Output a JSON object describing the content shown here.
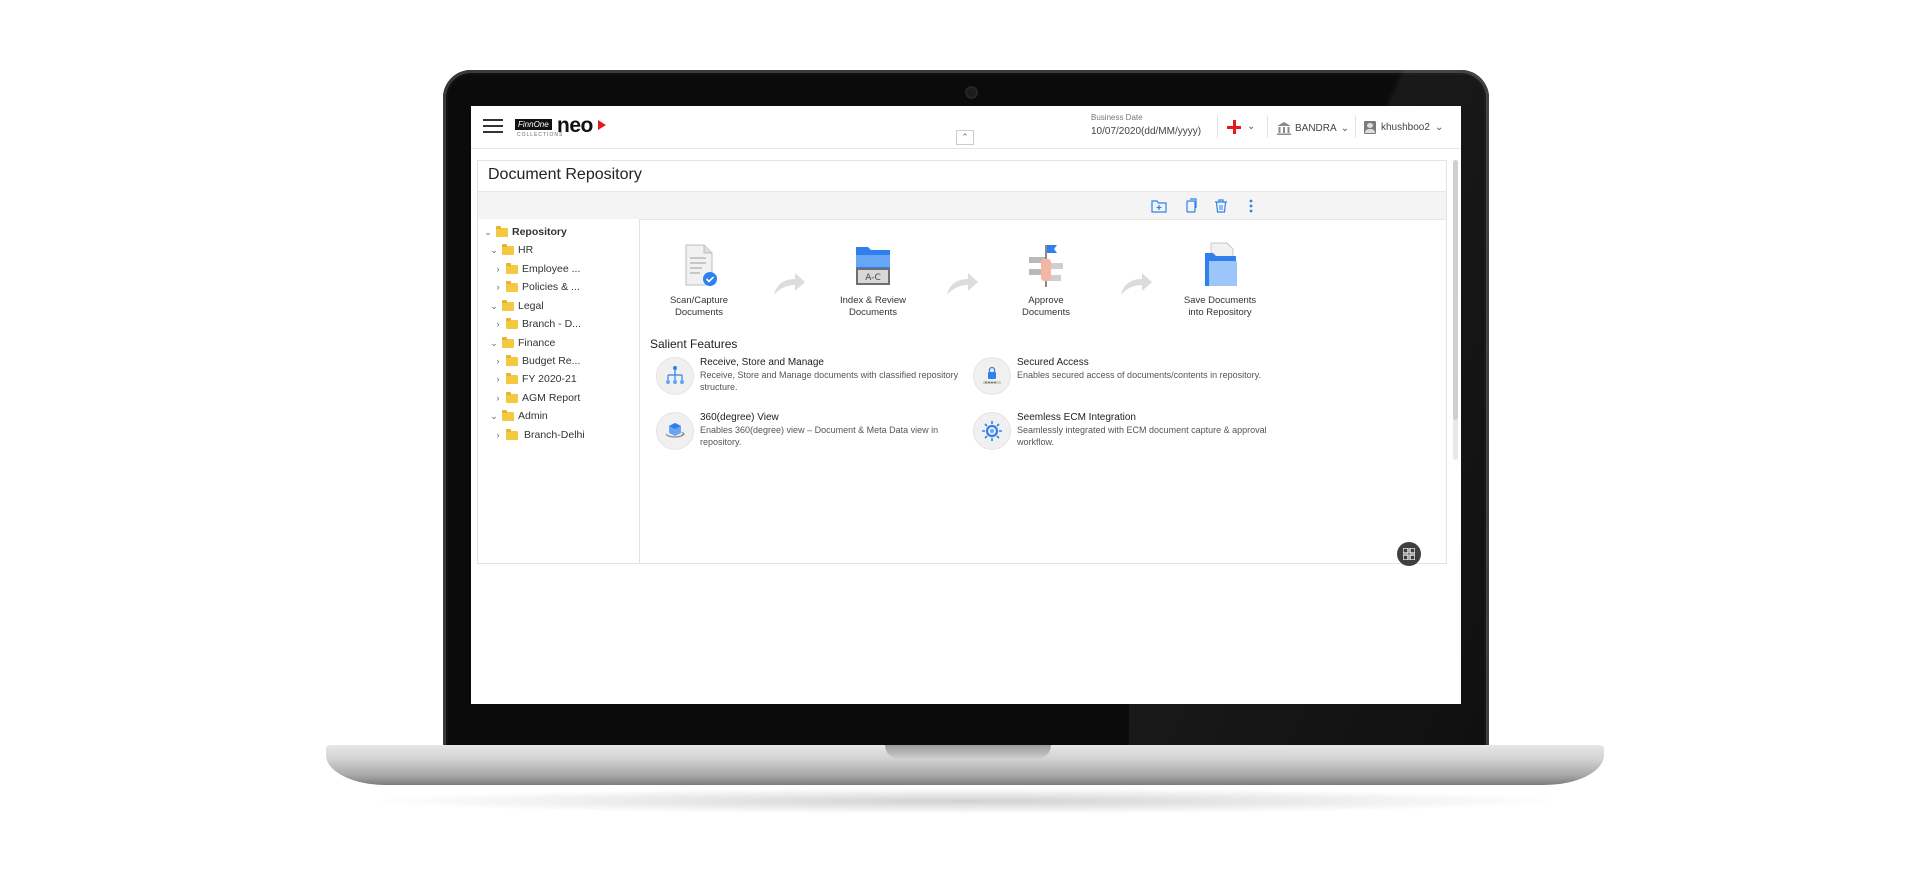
{
  "header": {
    "logo_brand": "FinnOne",
    "logo_product": "neo",
    "logo_sub": "COLLECTIONS",
    "business_date_label": "Business Date",
    "business_date_value": "10/07/2020(dd/MM/yyyy)",
    "branch": "BANDRA",
    "user": "khushboo2"
  },
  "page": {
    "title": "Document Repository"
  },
  "toolbar": {
    "icons": [
      "new-folder-icon",
      "copy-icon",
      "trash-icon",
      "more-vertical-icon"
    ]
  },
  "tree": {
    "root": "Repository",
    "items": [
      {
        "label": "HR",
        "level": 1,
        "expanded": true
      },
      {
        "label": "Employee ...",
        "level": 2,
        "expanded": false
      },
      {
        "label": "Policies & ...",
        "level": 2,
        "expanded": false
      },
      {
        "label": "Legal",
        "level": 1,
        "expanded": true
      },
      {
        "label": "Branch - D...",
        "level": 2,
        "expanded": false
      },
      {
        "label": "Finance",
        "level": 1,
        "expanded": true
      },
      {
        "label": "Budget Re...",
        "level": 2,
        "expanded": false
      },
      {
        "label": "FY 2020-21",
        "level": 2,
        "expanded": false
      },
      {
        "label": "AGM Report",
        "level": 2,
        "expanded": false
      },
      {
        "label": "Admin",
        "level": 1,
        "expanded": true
      },
      {
        "label": "Branch-Delhi",
        "level": 2,
        "expanded": false
      }
    ]
  },
  "workflow": {
    "steps": [
      {
        "line1": "Scan/Capture",
        "line2": "Documents"
      },
      {
        "line1": "Index & Review",
        "line2": "Documents"
      },
      {
        "line1": "Approve",
        "line2": "Documents"
      },
      {
        "line1": "Save Documents",
        "line2": "into Repository"
      }
    ],
    "index_badge": "A-C"
  },
  "salient": {
    "heading": "Salient Features",
    "features": [
      {
        "title": "Receive, Store and Manage",
        "desc": "Receive, Store and Manage documents with classified repository structure."
      },
      {
        "title": "Secured Access",
        "desc": "Enables secured access of documents/contents in repository."
      },
      {
        "title": "360(degree) View",
        "desc": "Enables 360(degree) view – Document & Meta Data view in repository."
      },
      {
        "title": "Seemless ECM Integration",
        "desc": "Seamlessly integrated with ECM document capture & approval workflow."
      }
    ]
  },
  "colors": {
    "accent_blue": "#2f80ed",
    "flag_red": "#e21b1b",
    "folder_yellow": "#f5c842"
  }
}
